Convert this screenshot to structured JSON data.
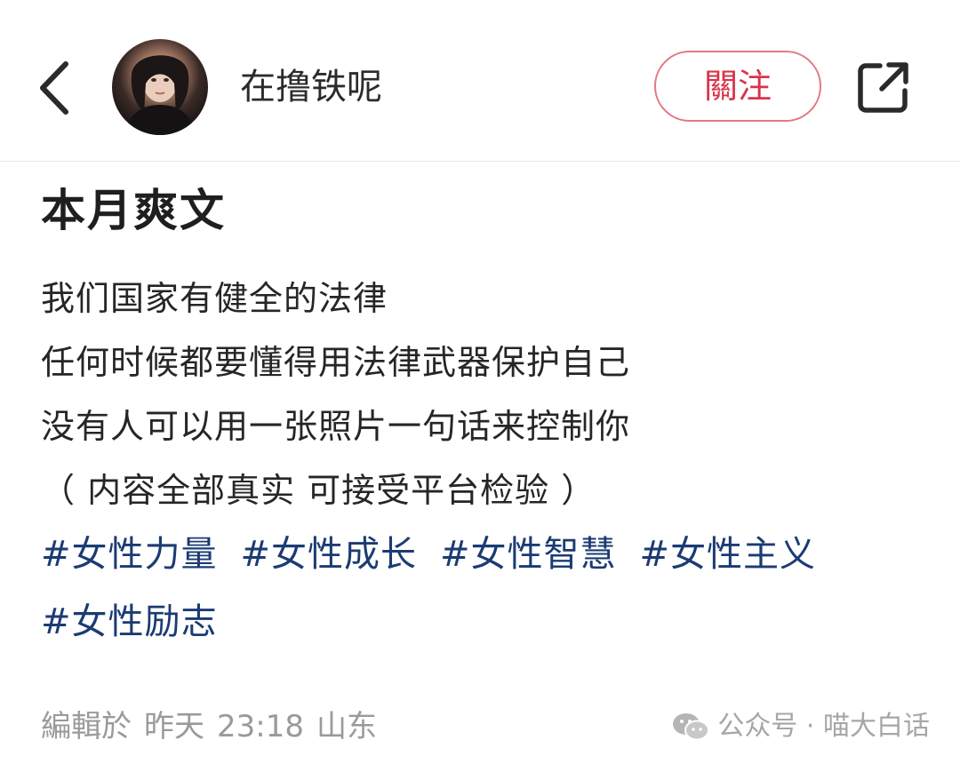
{
  "header": {
    "username": "在撸铁呢",
    "follow_label": "關注"
  },
  "post": {
    "title": "本月爽文",
    "lines": [
      "我们国家有健全的法律",
      "任何时候都要懂得用法律武器保护自己",
      "没有人可以用一张照片一句话来控制你",
      "（ 内容全部真实 可接受平台检验 ）"
    ],
    "tags": [
      "#女性力量",
      "#女性成长",
      "#女性智慧",
      "#女性主义",
      "#女性励志"
    ]
  },
  "meta": {
    "edited_label": "編輯於",
    "date": "昨天",
    "time": "23:18",
    "location": "山东"
  },
  "watermark": {
    "text": "公众号 · 喵大白话"
  },
  "colors": {
    "follow_accent": "#d8344a",
    "tag_color": "#1b3b73"
  },
  "icons": {
    "back": "chevron-left-icon",
    "share": "share-external-icon",
    "watermark": "wechat-icon"
  }
}
